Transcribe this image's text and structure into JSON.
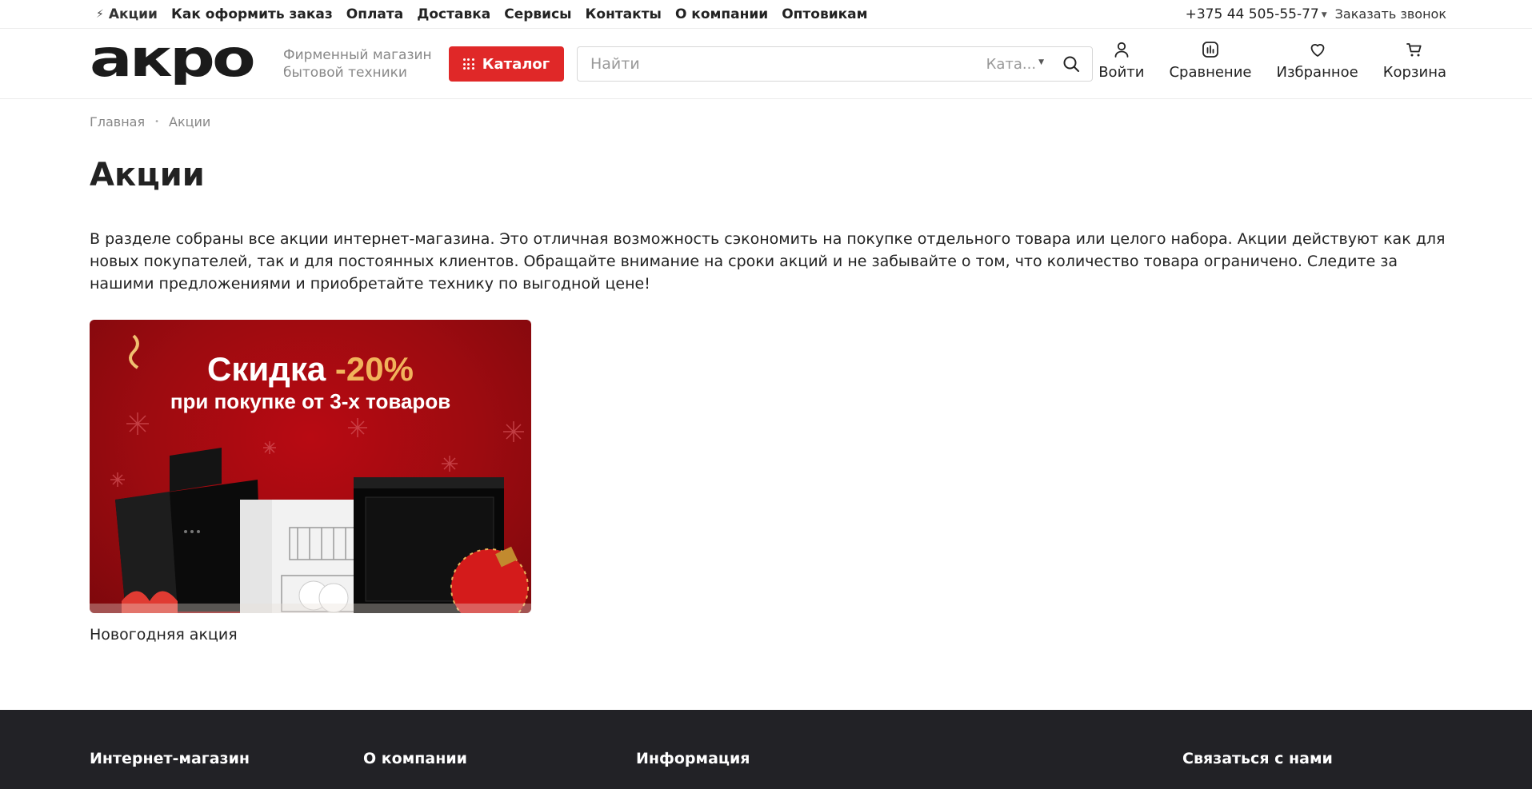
{
  "topbar": {
    "nav": [
      "Акции",
      "Как оформить заказ",
      "Оплата",
      "Доставка",
      "Сервисы",
      "Контакты",
      "О компании",
      "Оптовикам"
    ],
    "phone": "+375 44 505-55-77",
    "callback": "Заказать звонок"
  },
  "header": {
    "logo_text": "акро",
    "tagline_line1": "Фирменный магазин",
    "tagline_line2": "бытовой техники",
    "catalog_label": "Каталог",
    "search_placeholder": "Найти",
    "search_category": "Ката...",
    "actions": {
      "login": "Войти",
      "compare": "Сравнение",
      "favorites": "Избранное",
      "cart": "Корзина"
    }
  },
  "breadcrumb": [
    "Главная",
    "Акции"
  ],
  "page": {
    "title": "Акции",
    "intro": "В разделе собраны все акции интернет-магазина. Это отличная возможность сэкономить на покупке отдельного товара или целого набора. Акции действуют как для новых покупателей, так и для постоянных клиентов. Обращайте внимание на сроки акций и не забывайте о том, что количество товара ограничено. Следите за нашими предложениями и приобретайте технику по выгодной цене!"
  },
  "promo": {
    "banner_title": "Скидка ",
    "banner_percent": "-20%",
    "banner_subtitle": "при покупке от 3-х товаров",
    "caption": "Новогодняя акция"
  },
  "footer": {
    "columns": [
      "Интернет-магазин",
      "О компании",
      "Информация",
      "Связаться с нами"
    ]
  },
  "colors": {
    "accent": "#e02828",
    "footer_bg": "#222226",
    "banner_red": "#9c0b10",
    "banner_gold": "#f1b35b"
  }
}
